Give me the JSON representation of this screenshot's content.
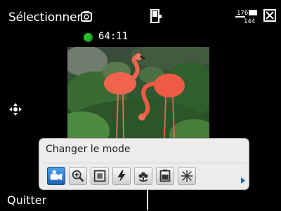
{
  "topbar": {
    "title": "Sélectionner",
    "resolution_top": "176",
    "resolution_bottom": "144"
  },
  "recording": {
    "timer": "64:11",
    "status_color": "#25c22f"
  },
  "mode_panel": {
    "title": "Changer le mode",
    "selected_index": 0,
    "buttons": [
      {
        "icon": "video-camera-icon"
      },
      {
        "icon": "zoom-icon"
      },
      {
        "icon": "frame-icon"
      },
      {
        "icon": "flash-icon"
      },
      {
        "icon": "macro-flower-icon"
      },
      {
        "icon": "exposure-icon"
      },
      {
        "icon": "white-balance-icon"
      }
    ]
  },
  "softkeys": {
    "left": "Quitter"
  },
  "colors": {
    "accent": "#1c63b6",
    "panel_bg": "#ececec"
  }
}
